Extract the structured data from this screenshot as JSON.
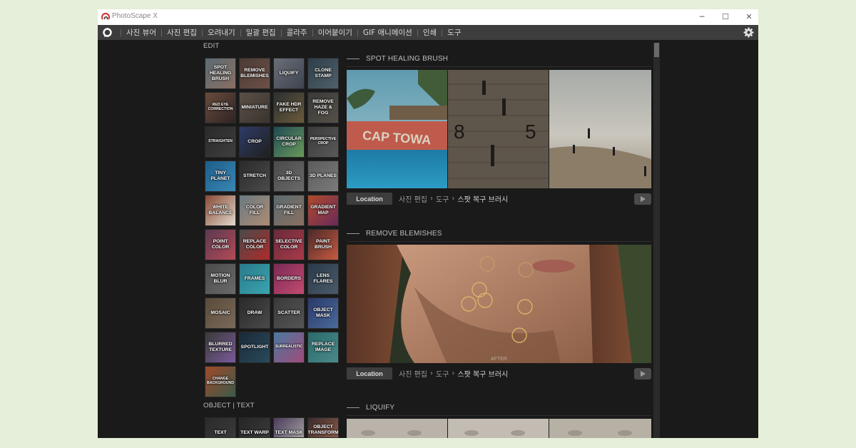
{
  "window": {
    "title": "PhotoScape X",
    "minimize": "─",
    "maximize": "☐",
    "close": "✕"
  },
  "menu": {
    "items": [
      "사진 뷰어",
      "사진 편집",
      "오려내기",
      "일괄 편집",
      "콜라주",
      "이어붙이기",
      "GIF 애니메이션",
      "인쇄",
      "도구"
    ]
  },
  "sidebar": {
    "edit_label": "EDIT",
    "object_label": "OBJECT | TEXT",
    "edit_tools": [
      "SPOT HEALING BRUSH",
      "REMOVE BLEMISHES",
      "LIQUIFY",
      "CLONE STAMP",
      "RED EYE CORRECTION",
      "MINIATURE",
      "FAKE HDR EFFECT",
      "REMOVE HAZE & FOG",
      "STRAIGHTEN",
      "CROP",
      "CIRCULAR CROP",
      "PERSPECTIVE CROP",
      "TINY PLANET",
      "STRETCH",
      "3D OBJECTS",
      "3D PLANES",
      "WHITE BALANCE",
      "COLOR FILL",
      "GRADIENT FILL",
      "GRADIENT MAP",
      "POINT COLOR",
      "REPLACE COLOR",
      "SELECTIVE COLOR",
      "PAINT BRUSH",
      "MOTION BLUR",
      "FRAMES",
      "BORDERS",
      "LENS FLARES",
      "MOSAIC",
      "DRAW",
      "SCATTER",
      "OBJECT MASK",
      "BLURRED TEXTURE",
      "SPOTLIGHT",
      "SURREALISTIC",
      "REPLACE IMAGE",
      "CHANGE BACKGROUND"
    ],
    "object_tools": [
      "TEXT",
      "TEXT WARP",
      "TEXT MASK",
      "OBJECT TRANSFORM"
    ]
  },
  "content": {
    "sections": [
      {
        "title": "SPOT HEALING BRUSH",
        "location_label": "Location",
        "path": [
          "사진 편집",
          "도구"
        ],
        "path_current": "스팟 복구 브러시"
      },
      {
        "title": "REMOVE BLEMISHES",
        "location_label": "Location",
        "path": [
          "사진 편집",
          "도구"
        ],
        "path_current": "스팟 복구 브러시",
        "after_label": "AFTER"
      },
      {
        "title": "LIQUIFY"
      }
    ],
    "sample_sign_text": "CAP TOWA",
    "sample_numbers": [
      "8",
      "5"
    ]
  },
  "colors": {
    "window_bg": "#1a1a1a",
    "menubar_bg": "#3d3d3d",
    "page_bg": "#e5efd9",
    "accent_logo": "#d43b3b",
    "blemish_circle": "#d9b36a"
  },
  "icons": {
    "home": "home-icon",
    "settings": "gear-icon",
    "play": "play-icon"
  }
}
